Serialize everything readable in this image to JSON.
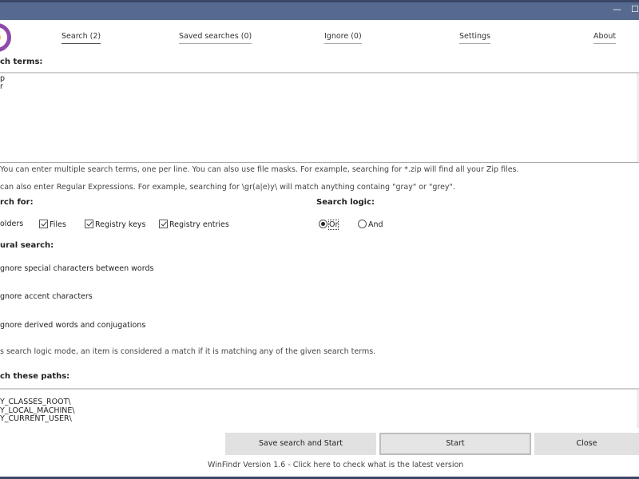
{
  "window": {
    "minimize": "—",
    "maximize": "☐"
  },
  "nav": {
    "tabs": [
      {
        "label": "Search (2)"
      },
      {
        "label": "Saved searches (0)"
      },
      {
        "label": "Ignore (0)"
      },
      {
        "label": "Settings"
      },
      {
        "label": "About"
      }
    ]
  },
  "search_terms": {
    "heading": "ch terms:",
    "lines": [
      "p",
      "r"
    ],
    "hint1": "You can enter multiple search terms, one per line. You can also use file masks. For example, searching for *.zip will find all your Zip files.",
    "hint2": "can also enter Regular Expressions. For example, searching for \\gr(a|e)y\\ will match anything containg \"gray\" or \"grey\"."
  },
  "search_for": {
    "heading": "rch for:",
    "options": [
      {
        "label": "olders"
      },
      {
        "label": "Files",
        "checked": true
      },
      {
        "label": "Registry keys",
        "checked": true
      },
      {
        "label": "Registry entries",
        "checked": true
      }
    ]
  },
  "search_logic": {
    "heading": "Search logic:",
    "options": [
      {
        "label": "Or",
        "selected": true
      },
      {
        "label": "And",
        "selected": false
      }
    ]
  },
  "natural": {
    "heading": "ural search:",
    "options": [
      "gnore special characters between words",
      "gnore accent characters",
      "gnore derived words and conjugations"
    ],
    "note": "s search logic mode, an item is considered a match if it is matching any of the given search terms."
  },
  "paths": {
    "heading": "ch these paths:",
    "lines": [
      "Y_CLASSES_ROOT\\",
      "Y_LOCAL_MACHINE\\",
      "Y_CURRENT_USER\\"
    ]
  },
  "buttons": {
    "save_start": "Save search and Start",
    "start": "Start",
    "close": "Close"
  },
  "footer": "WinFindr Version 1.6 - Click here to check what is the latest version"
}
